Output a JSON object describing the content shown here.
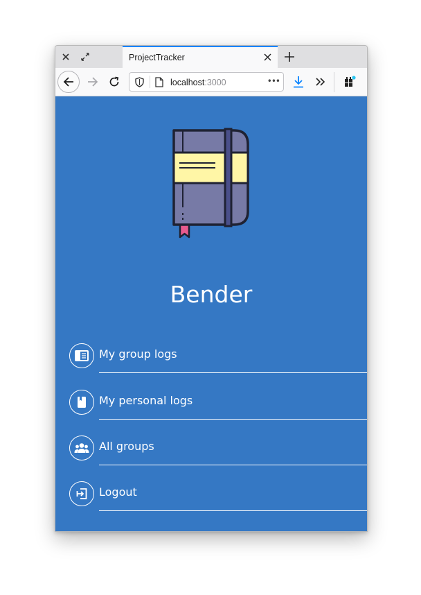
{
  "browser": {
    "tab_title": "ProjectTracker",
    "url_host": "localhost",
    "url_port": ":3000",
    "more_label": "•••"
  },
  "app": {
    "username": "Bender",
    "menu": [
      {
        "label": "My group logs",
        "icon": "group-log-icon"
      },
      {
        "label": "My personal logs",
        "icon": "personal-log-icon"
      },
      {
        "label": "All groups",
        "icon": "groups-icon"
      },
      {
        "label": "Logout",
        "icon": "logout-icon"
      }
    ]
  },
  "colors": {
    "background": "#3578c4",
    "notebook_cover": "#777aa6",
    "notebook_label": "#fff6a6",
    "bookmark": "#e95b8e",
    "accent": "#0a84ff"
  }
}
